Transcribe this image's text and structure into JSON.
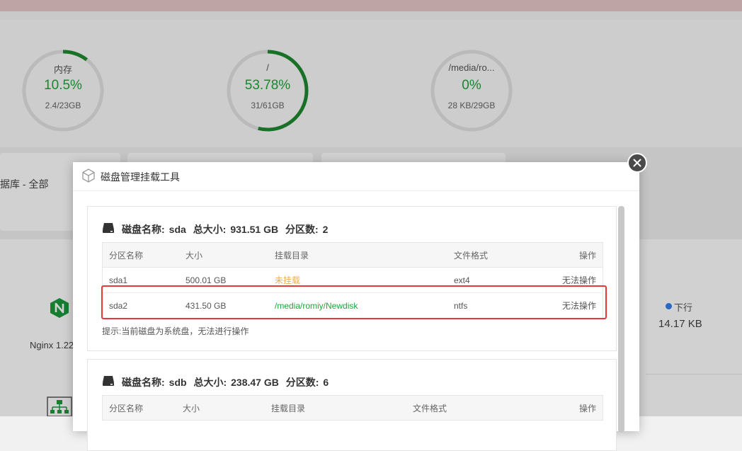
{
  "gauges": [
    {
      "label": "内存",
      "value": "10.5%",
      "sub": "2.4/23GB",
      "percent": 10.5
    },
    {
      "label": "/",
      "value": "53.78%",
      "sub": "31/61GB",
      "percent": 53.78
    },
    {
      "label": "/media/ro...",
      "value": "0%",
      "sub": "28 KB/29GB",
      "percent": 0
    }
  ],
  "database_label": "据库 - 全部",
  "nginx_label": "Nginx 1.22",
  "network": {
    "label": "下行",
    "value": "14.17 KB"
  },
  "modal": {
    "title": "磁盘管理挂载工具",
    "disks": [
      {
        "name_label": "磁盘名称:",
        "name": "sda",
        "size_label": "总大小:",
        "size": "931.51 GB",
        "count_label": "分区数:",
        "count": "2",
        "columns": [
          "分区名称",
          "大小",
          "挂载目录",
          "文件格式",
          "操作"
        ],
        "rows": [
          {
            "name": "sda1",
            "size": "500.01 GB",
            "mount": "未挂载",
            "fs": "ext4",
            "action": "无法操作"
          },
          {
            "name": "sda2",
            "size": "431.50 GB",
            "mount": "/media/romiy/Newdisk",
            "fs": "ntfs",
            "action": "无法操作"
          }
        ],
        "tip": "提示:当前磁盘为系统盘，无法进行操作"
      },
      {
        "name_label": "磁盘名称:",
        "name": "sdb",
        "size_label": "总大小:",
        "size": "238.47 GB",
        "count_label": "分区数:",
        "count": "6",
        "columns": [
          "分区名称",
          "大小",
          "挂载目录",
          "文件格式",
          "操作"
        ]
      }
    ]
  },
  "colors": {
    "accent": "#20a53a",
    "unmounted": "#f0ad4e",
    "highlight": "#e53935",
    "download": "#2f7ff0"
  }
}
